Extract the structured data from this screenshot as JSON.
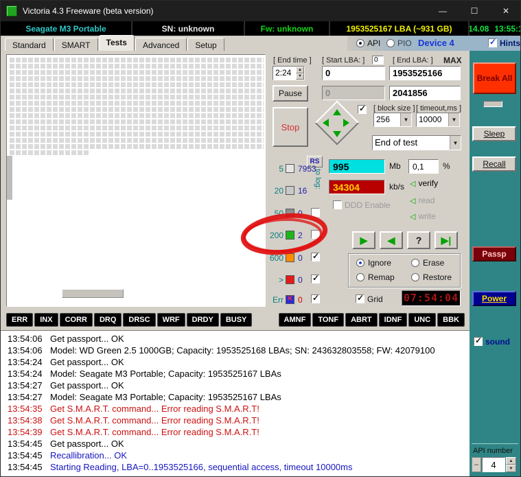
{
  "window": {
    "title": "Victoria 4.3 Freeware (beta version)"
  },
  "icons": {
    "minimize": "—",
    "maximize": "☐",
    "close": "✕",
    "dropdown": "▼",
    "spin_up": "▲",
    "spin_down": "▼",
    "check": "✓",
    "play": "▶",
    "back": "◀",
    "question": "?",
    "skip_end": "▶|",
    "arrow_left": "◁",
    "err_x": "✕",
    "minus": "–"
  },
  "info_bar": {
    "model": "Seagate M3 Portable",
    "serial": "SN: unknown",
    "firmware": "Fw: unknown",
    "capacity": "1953525167 LBA (~931 GB)",
    "date": "14.08",
    "time": "13:55:1"
  },
  "tabs": [
    {
      "label": "Standard",
      "active": false
    },
    {
      "label": "SMART",
      "active": false
    },
    {
      "label": "Tests",
      "active": true
    },
    {
      "label": "Advanced",
      "active": false
    },
    {
      "label": "Setup",
      "active": false
    }
  ],
  "mode_bar": {
    "api": "API",
    "pio": "PIO",
    "device": "Device 4",
    "hints": "Hints"
  },
  "test_controls": {
    "end_time_label": "[ End time ]",
    "end_time_value": "2:24",
    "start_lba_label": "[ Start LBA: ]",
    "start_lba_mini": "0",
    "end_lba_label": "[ End LBA: ]",
    "max_label": "MAX",
    "start_lba_value": "0",
    "end_lba_value": "1953525166",
    "pause_label": "Pause",
    "position_value": "0",
    "blocks_value": "2041856",
    "stop_label": "Stop",
    "block_size_label": "[ block size ]",
    "block_size_value": "256",
    "timeout_label": "[ timeout,ms ]",
    "timeout_value": "10000",
    "end_of_test_value": "End of test"
  },
  "legend": {
    "rs_label": "RS",
    "to_log_label": "to log:",
    "rows": [
      {
        "label": "5",
        "value": "7953",
        "color": "#E6E6E6",
        "has_checkbox": false,
        "checked": false
      },
      {
        "label": "20",
        "value": "16",
        "color": "#C9C9C9",
        "has_checkbox": false,
        "checked": false
      },
      {
        "label": "50",
        "value": "0",
        "color": "#8F8F8F",
        "has_checkbox": true,
        "checked": false
      },
      {
        "label": "200",
        "value": "2",
        "color": "#1CB51C",
        "has_checkbox": true,
        "checked": false
      },
      {
        "label": "600",
        "value": "0",
        "color": "#FF8C00",
        "has_checkbox": true,
        "checked": true
      },
      {
        "label": ">",
        "value": "0",
        "color": "#E41B1B",
        "has_checkbox": true,
        "checked": true
      },
      {
        "label": "Err",
        "value": "0",
        "color": "#2B2BD8",
        "has_checkbox": true,
        "checked": true
      }
    ]
  },
  "speed_panel": {
    "buffer_value": "995",
    "buffer_unit": "Mb",
    "percent_value": "0,1",
    "percent_unit": "%",
    "rate_value": "34304",
    "rate_unit": "kb/s",
    "actions": [
      {
        "label": "verify",
        "enabled": true
      },
      {
        "label": "read",
        "enabled": false
      },
      {
        "label": "write",
        "enabled": false
      }
    ],
    "ddd_label": "DDD Enable",
    "defect_options": [
      {
        "label": "Ignore",
        "selected": true
      },
      {
        "label": "Erase",
        "selected": false
      },
      {
        "label": "Remap",
        "selected": false
      },
      {
        "label": "Restore",
        "selected": false
      }
    ],
    "grid_label": "Grid",
    "timer_value": "07:54:04"
  },
  "right_panel": {
    "break_all": "Break All",
    "sleep": "Sleep",
    "recall": "Recall",
    "passp": "Passp",
    "power": "Power",
    "sound_label": "sound",
    "api_number_label": "API number",
    "api_number_value": "4"
  },
  "status_flags": [
    "ERR",
    "INX",
    "CORR",
    "DRQ",
    "DRSC",
    "WRF",
    "DRDY",
    "BUSY"
  ],
  "error_flags": [
    "AMNF",
    "TONF",
    "ABRT",
    "IDNF",
    "UNC",
    "BBK"
  ],
  "log": {
    "lines": [
      {
        "time": "13:54:06",
        "text": "Get passport... OK",
        "color": "black"
      },
      {
        "time": "13:54:06",
        "text": "Model: WD Green 2.5 1000GB; Capacity: 1953525168 LBAs; SN: 243632803558; FW: 42079100",
        "color": "black"
      },
      {
        "time": "13:54:24",
        "text": "Get passport... OK",
        "color": "black"
      },
      {
        "time": "13:54:24",
        "text": "Model: Seagate M3 Portable; Capacity: 1953525167 LBAs",
        "color": "black"
      },
      {
        "time": "13:54:27",
        "text": "Get passport... OK",
        "color": "black"
      },
      {
        "time": "13:54:27",
        "text": "Model: Seagate M3 Portable; Capacity: 1953525167 LBAs",
        "color": "black"
      },
      {
        "time": "13:54:35",
        "text": "Get S.M.A.R.T. command... Error reading S.M.A.R.T!",
        "color": "red"
      },
      {
        "time": "13:54:38",
        "text": "Get S.M.A.R.T. command... Error reading S.M.A.R.T!",
        "color": "red"
      },
      {
        "time": "13:54:39",
        "text": "Get S.M.A.R.T. command... Error reading S.M.A.R.T!",
        "color": "red"
      },
      {
        "time": "13:54:45",
        "text": "Get passport... OK",
        "color": "black"
      },
      {
        "time": "13:54:45",
        "text": "Recallibration... OK",
        "color": "blue"
      },
      {
        "time": "13:54:45",
        "text": "Starting Reading, LBA=0..1953525166, sequential access, timeout 10000ms",
        "color": "blue"
      }
    ]
  },
  "colors": {
    "teal_background": "#2F8585",
    "panel_gray": "#D4D0C8",
    "buffer_bg": "#00E0E0",
    "rate_bg": "#B80000",
    "break_all_bg": "#FF3000",
    "passp_bg": "#7A000A",
    "power_bg": "#000090",
    "annotation_red": "#E01010"
  }
}
